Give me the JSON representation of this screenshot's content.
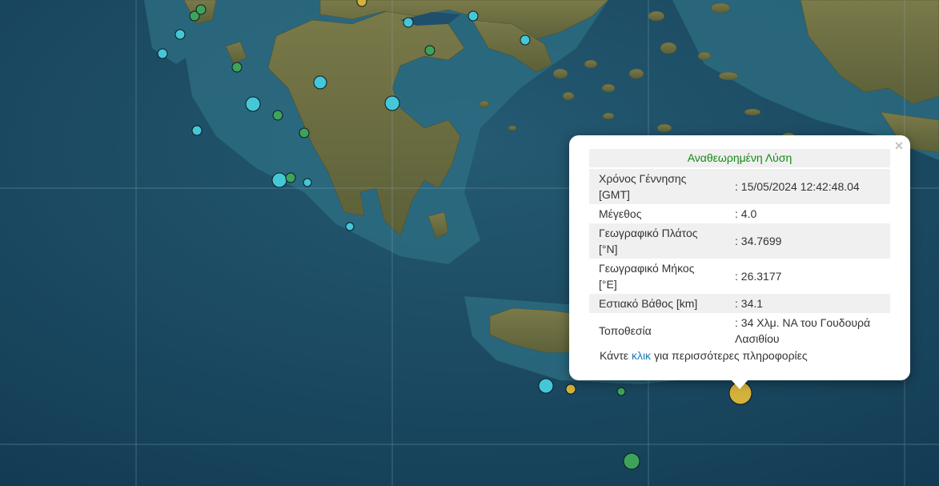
{
  "map": {
    "colors": {
      "sea_deep": "#123a52",
      "sea_shelf": "#2e6f84",
      "land": "#6b6a3e",
      "graticule": "#8fa6b5"
    },
    "markers": [
      {
        "color": "#44c7d6"
      },
      {
        "color": "#44c7d6"
      },
      {
        "color": "#44c7d6"
      },
      {
        "color": "#44c7d6"
      },
      {
        "color": "#44c7d6"
      },
      {
        "color": "#44c7d6"
      },
      {
        "color": "#44c7d6"
      },
      {
        "color": "#44c7d6"
      },
      {
        "color": "#44c7d6"
      },
      {
        "color": "#44c7d6"
      },
      {
        "color": "#44c7d6"
      },
      {
        "color": "#44c7d6"
      },
      {
        "color": "#44c7d6"
      },
      {
        "color": "#3ea35a"
      },
      {
        "color": "#3ea35a"
      },
      {
        "color": "#3ea35a"
      },
      {
        "color": "#3ea35a"
      },
      {
        "color": "#3ea35a"
      },
      {
        "color": "#3ea35a"
      },
      {
        "color": "#3ea35a"
      },
      {
        "color": "#3ea35a"
      },
      {
        "color": "#3ea35a"
      },
      {
        "color": "#d4b23c"
      },
      {
        "color": "#d4b23c"
      },
      {
        "color": "#d4b23c"
      }
    ]
  },
  "popup": {
    "title": "Αναθεωρημένη Λύση",
    "close_label": "×",
    "rows": [
      {
        "label": "Χρόνος Γέννησης [GMT]",
        "value": ": 15/05/2024 12:42:48.04"
      },
      {
        "label": "Μέγεθος",
        "value": ": 4.0"
      },
      {
        "label": "Γεωγραφικό Πλάτος [°N]",
        "value": ": 34.7699"
      },
      {
        "label": "Γεωγραφικό Μήκος [°E]",
        "value": ": 26.3177"
      },
      {
        "label": "Εστιακό Βάθος [km]",
        "value": ": 34.1"
      },
      {
        "label": "Τοποθεσία",
        "value": ": 34 Χλμ. ΝΑ του Γουδουρά Λασιθίου"
      }
    ],
    "more_prefix": "Κάντε",
    "more_link": "κλικ",
    "more_suffix": "για περισσότερες πληροφορίες"
  }
}
